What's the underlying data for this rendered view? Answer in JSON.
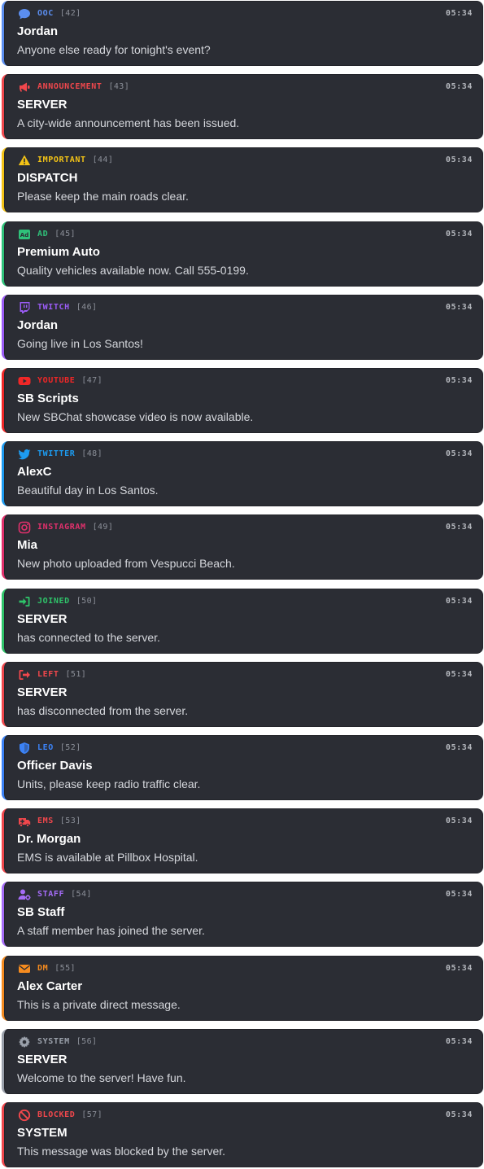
{
  "messages": [
    {
      "type": "OOC",
      "id": "[42]",
      "time": "05:34",
      "author": "Jordan",
      "text": "Anyone else ready for tonight's event?",
      "color": "#5b8ef0",
      "icon": "speech-bubble-icon"
    },
    {
      "type": "ANNOUNCEMENT",
      "id": "[43]",
      "time": "05:34",
      "author": "SERVER",
      "text": "A city-wide announcement has been issued.",
      "color": "#f0474c",
      "icon": "megaphone-icon"
    },
    {
      "type": "IMPORTANT",
      "id": "[44]",
      "time": "05:34",
      "author": "DISPATCH",
      "text": "Please keep the main roads clear.",
      "color": "#f3c316",
      "icon": "warning-icon"
    },
    {
      "type": "AD",
      "id": "[45]",
      "time": "05:34",
      "author": "Premium Auto",
      "text": "Quality vehicles available now. Call 555-0199.",
      "color": "#2fc27a",
      "icon": "ad-icon"
    },
    {
      "type": "TWITCH",
      "id": "[46]",
      "time": "05:34",
      "author": "Jordan",
      "text": "Going live in Los Santos!",
      "color": "#9b5cf6",
      "icon": "twitch-icon"
    },
    {
      "type": "YOUTUBE",
      "id": "[47]",
      "time": "05:34",
      "author": "SB Scripts",
      "text": "New SBChat showcase video is now available.",
      "color": "#f02727",
      "icon": "youtube-icon"
    },
    {
      "type": "TWITTER",
      "id": "[48]",
      "time": "05:34",
      "author": "AlexC",
      "text": "Beautiful day in Los Santos.",
      "color": "#1d9bf0",
      "icon": "twitter-icon"
    },
    {
      "type": "INSTAGRAM",
      "id": "[49]",
      "time": "05:34",
      "author": "Mia",
      "text": "New photo uploaded from Vespucci Beach.",
      "color": "#e1306c",
      "icon": "instagram-icon"
    },
    {
      "type": "JOINED",
      "id": "[50]",
      "time": "05:34",
      "author": "SERVER",
      "text": "has connected to the server.",
      "color": "#2fc46a",
      "icon": "sign-in-icon"
    },
    {
      "type": "LEFT",
      "id": "[51]",
      "time": "05:34",
      "author": "SERVER",
      "text": "has disconnected from the server.",
      "color": "#f0474c",
      "icon": "sign-out-icon"
    },
    {
      "type": "LEO",
      "id": "[52]",
      "time": "05:34",
      "author": "Officer Davis",
      "text": "Units, please keep radio traffic clear.",
      "color": "#3b82f6",
      "icon": "shield-icon"
    },
    {
      "type": "EMS",
      "id": "[53]",
      "time": "05:34",
      "author": "Dr. Morgan",
      "text": "EMS is available at Pillbox Hospital.",
      "color": "#f0474c",
      "icon": "ambulance-icon"
    },
    {
      "type": "STAFF",
      "id": "[54]",
      "time": "05:34",
      "author": "SB Staff",
      "text": "A staff member has joined the server.",
      "color": "#a56cf7",
      "icon": "user-gear-icon"
    },
    {
      "type": "DM",
      "id": "[55]",
      "time": "05:34",
      "author": "Alex Carter",
      "text": "This is a private direct message.",
      "color": "#f58b1f",
      "icon": "envelope-icon"
    },
    {
      "type": "SYSTEM",
      "id": "[56]",
      "time": "05:34",
      "author": "SERVER",
      "text": "Welcome to the server! Have fun.",
      "color": "#9aa0aa",
      "icon": "gear-icon"
    },
    {
      "type": "BLOCKED",
      "id": "[57]",
      "time": "05:34",
      "author": "SYSTEM",
      "text": "This message was blocked by the server.",
      "color": "#f0474c",
      "icon": "ban-icon"
    }
  ]
}
